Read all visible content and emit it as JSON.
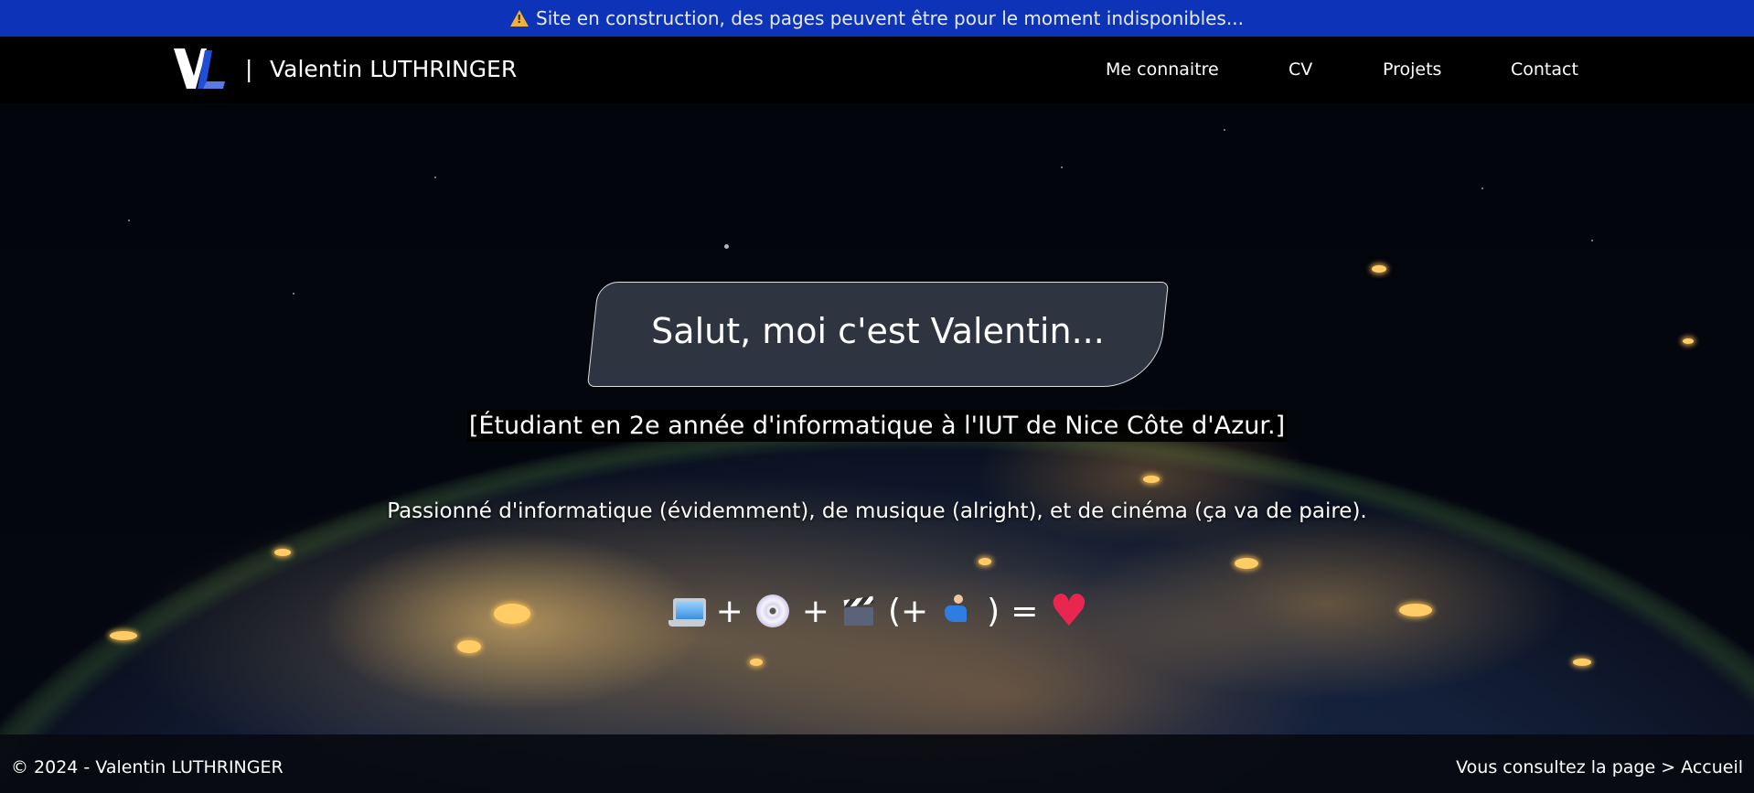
{
  "banner": {
    "icon": "warning-icon",
    "text": "Site en construction, des pages peuvent être pour le moment indisponibles..."
  },
  "header": {
    "logo_text": "VL",
    "separator": "|",
    "brand_name": "Valentin LUTHRINGER",
    "nav": [
      {
        "label": "Me connaitre"
      },
      {
        "label": "CV"
      },
      {
        "label": "Projets"
      },
      {
        "label": "Contact"
      }
    ]
  },
  "hero": {
    "title": "Salut, moi c'est Valentin...",
    "subtitle": "[Étudiant en 2e année d'informatique à l'IUT de Nice Côte d'Azur.]",
    "passion": "Passionné d'informatique (évidemment), de musique (alright), et de cinéma (ça va de paire).",
    "emoji_equation": {
      "plus": "+",
      "open_paren": "(+",
      "close_paren": ")",
      "equals": "=",
      "icons": [
        "laptop-icon",
        "dvd-icon",
        "clapper-board-icon",
        "skier-icon",
        "heart-icon"
      ]
    }
  },
  "footer": {
    "copyright": "© 2024 - Valentin LUTHRINGER",
    "location": "Vous consultez la page > Accueil"
  },
  "colors": {
    "banner_bg": "#0d33b8",
    "header_bg": "#000000",
    "logo_accent": "#1f4fd8",
    "text": "#ffffff"
  }
}
